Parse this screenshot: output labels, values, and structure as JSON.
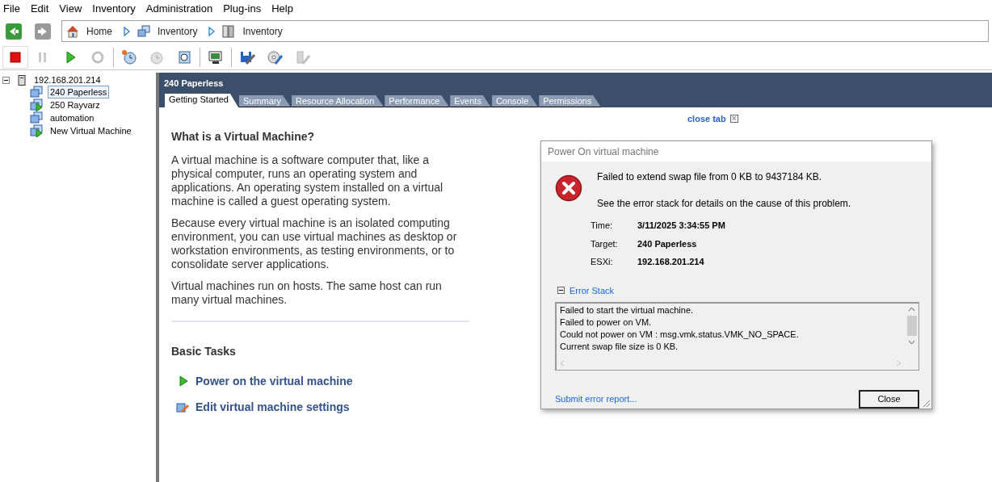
{
  "menu": [
    "File",
    "Edit",
    "View",
    "Inventory",
    "Administration",
    "Plug-ins",
    "Help"
  ],
  "nav": {
    "back_disabled": false,
    "forward_disabled": true,
    "breadcrumb": [
      {
        "label": "Home",
        "kind": "home"
      },
      {
        "label": "Inventory",
        "kind": "vms"
      },
      {
        "label": "Inventory",
        "kind": "hosts"
      }
    ]
  },
  "toolbar": [
    {
      "kind": "stop",
      "disabled": false
    },
    {
      "kind": "pause",
      "disabled": true
    },
    {
      "kind": "play",
      "disabled": false
    },
    {
      "kind": "reset",
      "disabled": true
    },
    {
      "kind": "snapshot",
      "disabled": false
    },
    {
      "kind": "revert",
      "disabled": true
    },
    {
      "kind": "manager",
      "disabled": false
    },
    {
      "kind": "console",
      "disabled": false
    },
    {
      "kind": "edit",
      "disabled": false
    },
    {
      "kind": "cd",
      "disabled": false
    },
    {
      "kind": "usb",
      "disabled": true
    }
  ],
  "tree": {
    "label": "192.168.201.214",
    "expanded": true,
    "children": [
      {
        "label": "240 Paperless",
        "powered_on": false,
        "selected": true
      },
      {
        "label": "250 Rayvarz",
        "powered_on": true,
        "selected": false
      },
      {
        "label": "automation",
        "powered_on": false,
        "selected": false
      },
      {
        "label": "New Virtual Machine",
        "powered_on": true,
        "selected": false
      }
    ]
  },
  "panel_title": "240 Paperless",
  "tabs": [
    {
      "label": "Getting Started",
      "selected": true
    },
    {
      "label": "Summary",
      "selected": false
    },
    {
      "label": "Resource Allocation",
      "selected": false
    },
    {
      "label": "Performance",
      "selected": false
    },
    {
      "label": "Events",
      "selected": false
    },
    {
      "label": "Console",
      "selected": false
    },
    {
      "label": "Permissions",
      "selected": false
    }
  ],
  "close_tab": "close tab",
  "close_tab_icon": "X",
  "heading": "What is a Virtual Machine?",
  "paragraphs": [
    "A virtual machine is a software computer that, like a physical computer, runs an operating system and applications. An operating system installed on a virtual machine is called a guest operating system.",
    "Because every virtual machine is an isolated computing environment, you can use virtual machines as desktop or workstation environments, as testing environments, or to consolidate server applications.",
    "Virtual machines run on hosts. The same host can run many virtual machines."
  ],
  "basic_tasks": {
    "title": "Basic Tasks",
    "items": [
      {
        "label": "Power on the virtual machine",
        "kind": "power"
      },
      {
        "label": "Edit virtual machine settings",
        "kind": "edit"
      }
    ]
  },
  "dialog": {
    "title": "Power On virtual machine",
    "message": "Failed to extend swap file from 0 KB to 9437184 KB.",
    "hint": "See the error stack for details on the cause of this problem.",
    "details": [
      {
        "label": "Time:",
        "value": "3/11/2025 3:34:55 PM"
      },
      {
        "label": "Target:",
        "value": "240 Paperless"
      },
      {
        "label": "ESXi:",
        "value": "192.168.201.214"
      }
    ],
    "error_stack": {
      "label": "Error Stack",
      "expanded": true,
      "lines": [
        "Failed to start the virtual machine.",
        "Failed to power on VM.",
        "Could not power on VM : msg.vmk.status.VMK_NO_SPACE.",
        "Current swap file size is 0 KB."
      ]
    },
    "report_link": "Submit error report...",
    "close_button": "Close"
  }
}
